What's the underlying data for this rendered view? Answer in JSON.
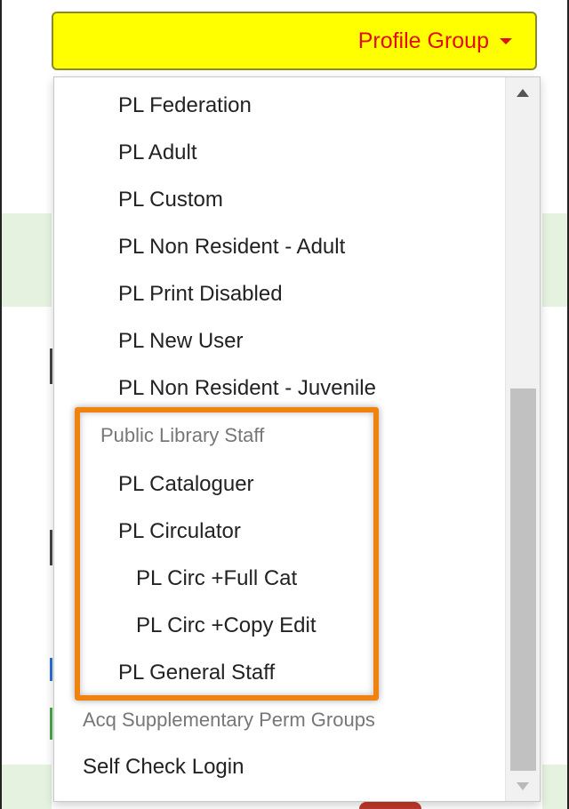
{
  "toggle": {
    "label": "Profile Group",
    "color": "#e01010",
    "background": "#ffff00"
  },
  "menu": {
    "items": [
      {
        "label": "PL Federation"
      },
      {
        "label": "PL Adult"
      },
      {
        "label": "PL Custom"
      },
      {
        "label": "PL Non Resident - Adult"
      },
      {
        "label": "PL Print Disabled"
      },
      {
        "label": "PL New User"
      },
      {
        "label": "PL Non Resident - Juvenile"
      },
      {
        "label": "Public Library Staff"
      },
      {
        "label": "PL Cataloguer"
      },
      {
        "label": "PL Circulator"
      },
      {
        "label": "PL Circ +Full Cat"
      },
      {
        "label": "PL Circ +Copy Edit"
      },
      {
        "label": "PL General Staff"
      },
      {
        "label": "Acq Supplementary Perm Groups"
      },
      {
        "label": "Self Check Login"
      }
    ]
  },
  "highlight_color": "#f0820f"
}
